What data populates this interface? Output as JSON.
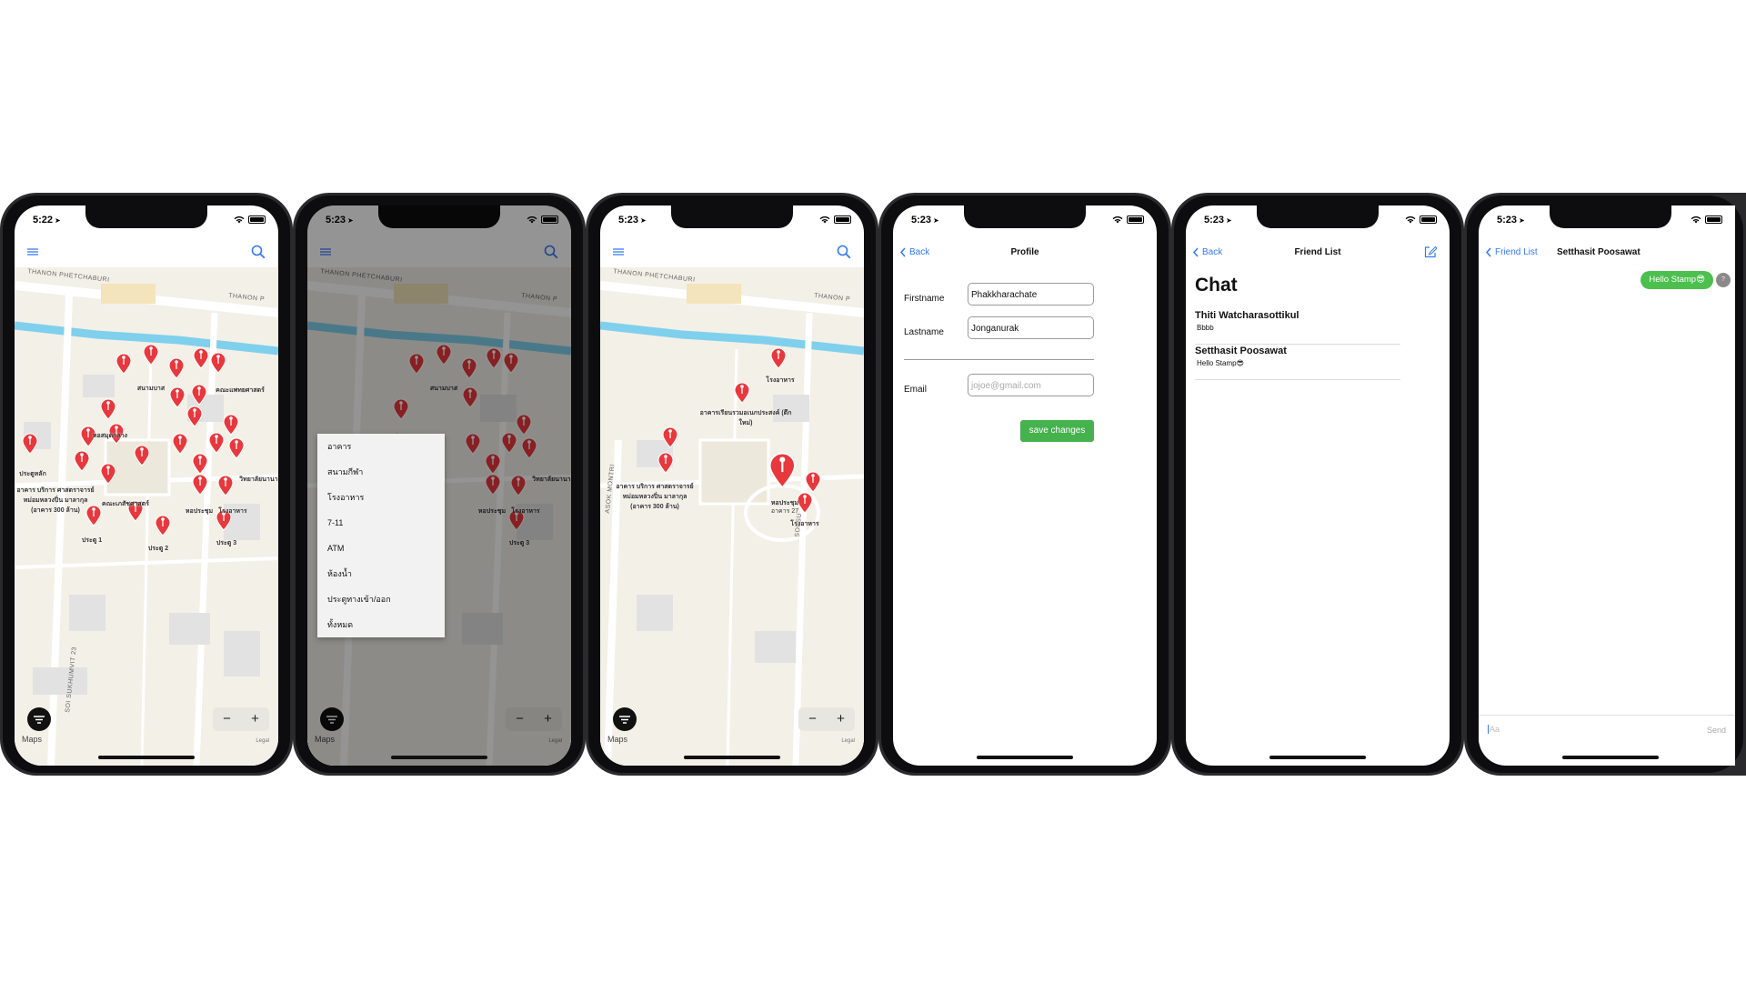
{
  "phones": [
    {
      "time": "5:22",
      "screen": "map"
    },
    {
      "time": "5:23",
      "screen": "map-filter"
    },
    {
      "time": "5:23",
      "screen": "map-selected"
    },
    {
      "time": "5:23",
      "screen": "profile"
    },
    {
      "time": "5:23",
      "screen": "friend-list"
    },
    {
      "time": "5:23",
      "screen": "conversation"
    }
  ],
  "map": {
    "road_top": "THANON PHETCHABURI",
    "road_top_right": "THANON P",
    "road_bottom": "SOI SUKHUMVIT 23",
    "road_bottom_right": "SOI SU",
    "road_left": "ASOK MONTRI",
    "maps_logo": "Maps",
    "legal": "Legal",
    "zoom_out": "−",
    "zoom_in": "+",
    "labels": {
      "gym": "สนามบาส",
      "pharm": "คณะเภสัชศาสตร์",
      "library": "หอสมุดกลาง",
      "gate_lake": "ประตูหลัก",
      "medicine": "คณะแพทยศาสตร์",
      "building_300": "อาคาร บริการ ศาสตราจารย์ หม่อมหลวงปิ่น มาลากุล (อาคาร 300 ล้าน)",
      "meeting": "หอประชุม",
      "canteen": "โรงอาหาร",
      "gate1": "ประตู 1",
      "gate2": "ประตู 2",
      "gate3": "ประตู 3",
      "hall": "อาคารเรียนรวมอเนกประสงค์ (ตึกใหม่)",
      "building27": "อาคาร 27",
      "school": "วิทยาลัยนานาชาติ"
    }
  },
  "filter_menu": [
    "อาคาร",
    "สนามกีฬา",
    "โรงอาหาร",
    "7-11",
    "ATM",
    "ห้องน้ำ",
    "ประตูทางเข้า/ออก",
    "ทั้งหมด"
  ],
  "profile": {
    "back": "Back",
    "title": "Profile",
    "firstname_label": "Firstname",
    "firstname_value": "Phakkharachate",
    "lastname_label": "Lastname",
    "lastname_value": "Jonganurak",
    "email_label": "Email",
    "email_placeholder": "jojoe@gmail.com",
    "save": "save changes"
  },
  "friend_list": {
    "back": "Back",
    "title": "Friend List",
    "heading": "Chat",
    "chats": [
      {
        "name": "Thiti Watcharasottikul",
        "message": "Bbbb"
      },
      {
        "name": "Setthasit Poosawat",
        "message": "Hello Stamp😎"
      }
    ]
  },
  "conversation": {
    "back": "Friend List",
    "title": "Setthasit Poosawat",
    "message": "Hello Stamp😎",
    "avatar": "?",
    "input_placeholder": "Aa",
    "send": "Send"
  },
  "colors": {
    "accent": "#3478f6",
    "pin": "#e8383d",
    "save": "#45b24e",
    "bubble": "#4cbf4f"
  }
}
